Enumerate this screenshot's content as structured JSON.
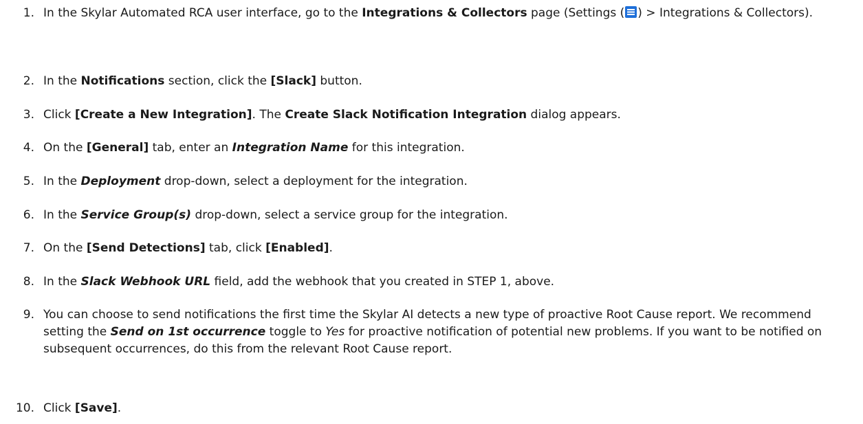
{
  "steps": [
    {
      "num": "1.",
      "parts": [
        {
          "t": "In the Skylar Automated RCA user interface, go to the ",
          "s": "n"
        },
        {
          "t": "Integrations & Collectors",
          "s": "b"
        },
        {
          "t": " page (Settings (",
          "s": "n"
        },
        {
          "icon": "settings-menu-icon"
        },
        {
          "t": ") > Integrations & Collectors).",
          "s": "n"
        }
      ]
    },
    {
      "num": "2.",
      "parts": [
        {
          "t": "In the ",
          "s": "n"
        },
        {
          "t": "Notifications",
          "s": "b"
        },
        {
          "t": " section, click the ",
          "s": "n"
        },
        {
          "t": "[Slack]",
          "s": "b"
        },
        {
          "t": " button.",
          "s": "n"
        }
      ]
    },
    {
      "num": "3.",
      "parts": [
        {
          "t": "Click ",
          "s": "n"
        },
        {
          "t": "[Create a New Integration]",
          "s": "b"
        },
        {
          "t": ". The ",
          "s": "n"
        },
        {
          "t": "Create Slack Notification Integration",
          "s": "b"
        },
        {
          "t": " dialog appears.",
          "s": "n"
        }
      ]
    },
    {
      "num": "4.",
      "parts": [
        {
          "t": "On the ",
          "s": "n"
        },
        {
          "t": "[General]",
          "s": "b"
        },
        {
          "t": " tab, enter an ",
          "s": "n"
        },
        {
          "t": "Integration Name",
          "s": "bi"
        },
        {
          "t": " for this integration.",
          "s": "n"
        }
      ]
    },
    {
      "num": "5.",
      "parts": [
        {
          "t": "In the ",
          "s": "n"
        },
        {
          "t": "Deployment",
          "s": "bi"
        },
        {
          "t": " drop-down, select a deployment for the integration.",
          "s": "n"
        }
      ]
    },
    {
      "num": "6.",
      "parts": [
        {
          "t": "In the ",
          "s": "n"
        },
        {
          "t": "Service Group(s)",
          "s": "bi"
        },
        {
          "t": " drop-down, select a service group for the integration.",
          "s": "n"
        }
      ]
    },
    {
      "num": "7.",
      "parts": [
        {
          "t": "On the ",
          "s": "n"
        },
        {
          "t": "[Send Detections]",
          "s": "b"
        },
        {
          "t": " tab, click ",
          "s": "n"
        },
        {
          "t": "[Enabled]",
          "s": "b"
        },
        {
          "t": ".",
          "s": "n"
        }
      ]
    },
    {
      "num": "8.",
      "parts": [
        {
          "t": "In the ",
          "s": "n"
        },
        {
          "t": "Slack Webhook URL",
          "s": "bi"
        },
        {
          "t": " field, add the webhook that you created in STEP 1, above.",
          "s": "n"
        }
      ]
    },
    {
      "num": "9.",
      "parts": [
        {
          "t": "You can choose to send notifications the first time the Skylar AI detects a new type of proactive Root Cause report. We recommend setting the ",
          "s": "n"
        },
        {
          "t": "Send on 1st occurrence",
          "s": "bi"
        },
        {
          "t": " toggle to ",
          "s": "n"
        },
        {
          "t": "Yes",
          "s": "i"
        },
        {
          "t": " for proactive notification of potential new problems. If you want to be notified on subsequent occurrences, do this from the relevant Root Cause report.",
          "s": "n"
        }
      ]
    },
    {
      "num": "10.",
      "parts": [
        {
          "t": "Click ",
          "s": "n"
        },
        {
          "t": "[Save]",
          "s": "b"
        },
        {
          "t": ".",
          "s": "n"
        }
      ]
    }
  ],
  "colors": {
    "text": "#1a1a1a",
    "icon_blue": "#1e6fd9"
  }
}
